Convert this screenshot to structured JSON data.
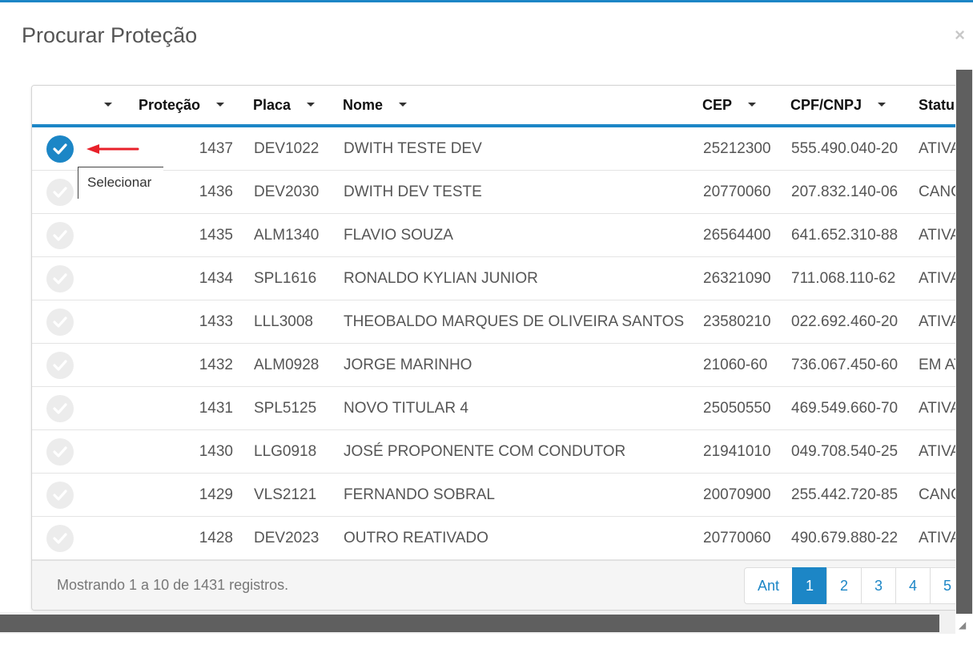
{
  "modal": {
    "title": "Procurar Proteção",
    "close_label": "×"
  },
  "columns": {
    "protecao": "Proteção",
    "placa": "Placa",
    "nome": "Nome",
    "cep": "CEP",
    "cpf": "CPF/CNPJ",
    "status": "Statu"
  },
  "rows": [
    {
      "selected": true,
      "protecao": "1437",
      "placa": "DEV1022",
      "nome": "DWITH TESTE DEV",
      "cep": "25212300",
      "cpf": "555.490.040-20",
      "status": "ATIVA"
    },
    {
      "selected": false,
      "protecao": "1436",
      "placa": "DEV2030",
      "nome": "DWITH DEV TESTE",
      "cep": "20770060",
      "cpf": "207.832.140-06",
      "status": "CANC"
    },
    {
      "selected": false,
      "protecao": "1435",
      "placa": "ALM1340",
      "nome": "FLAVIO SOUZA",
      "cep": "26564400",
      "cpf": "641.652.310-88",
      "status": "ATIVA"
    },
    {
      "selected": false,
      "protecao": "1434",
      "placa": "SPL1616",
      "nome": "RONALDO KYLIAN JUNIOR",
      "cep": "26321090",
      "cpf": "711.068.110-62",
      "status": "ATIVA"
    },
    {
      "selected": false,
      "protecao": "1433",
      "placa": "LLL3008",
      "nome": "THEOBALDO MARQUES DE OLIVEIRA SANTOS",
      "cep": "23580210",
      "cpf": "022.692.460-20",
      "status": "ATIVA"
    },
    {
      "selected": false,
      "protecao": "1432",
      "placa": "ALM0928",
      "nome": "JORGE MARINHO",
      "cep": "21060-60",
      "cpf": "736.067.450-60",
      "status": "EM AT"
    },
    {
      "selected": false,
      "protecao": "1431",
      "placa": "SPL5125",
      "nome": "NOVO TITULAR 4",
      "cep": "25050550",
      "cpf": "469.549.660-70",
      "status": "ATIVA"
    },
    {
      "selected": false,
      "protecao": "1430",
      "placa": "LLG0918",
      "nome": "JOSÉ PROPONENTE COM CONDUTOR",
      "cep": "21941010",
      "cpf": "049.708.540-25",
      "status": "ATIVA"
    },
    {
      "selected": false,
      "protecao": "1429",
      "placa": "VLS2121",
      "nome": "FERNANDO SOBRAL",
      "cep": "20070900",
      "cpf": "255.442.720-85",
      "status": "CANC"
    },
    {
      "selected": false,
      "protecao": "1428",
      "placa": "DEV2023",
      "nome": "OUTRO REATIVADO",
      "cep": "20770060",
      "cpf": "490.679.880-22",
      "status": "ATIVA"
    }
  ],
  "footer": {
    "info": "Mostrando 1 a 10 de 1431 registros."
  },
  "pagination": {
    "prev": "Ant",
    "pages": [
      "1",
      "2",
      "3",
      "4",
      "5"
    ],
    "current": "1"
  },
  "tooltip": {
    "text": "Selecionar"
  },
  "colors": {
    "accent": "#1c86c6",
    "annotation_arrow": "#e8202a"
  }
}
